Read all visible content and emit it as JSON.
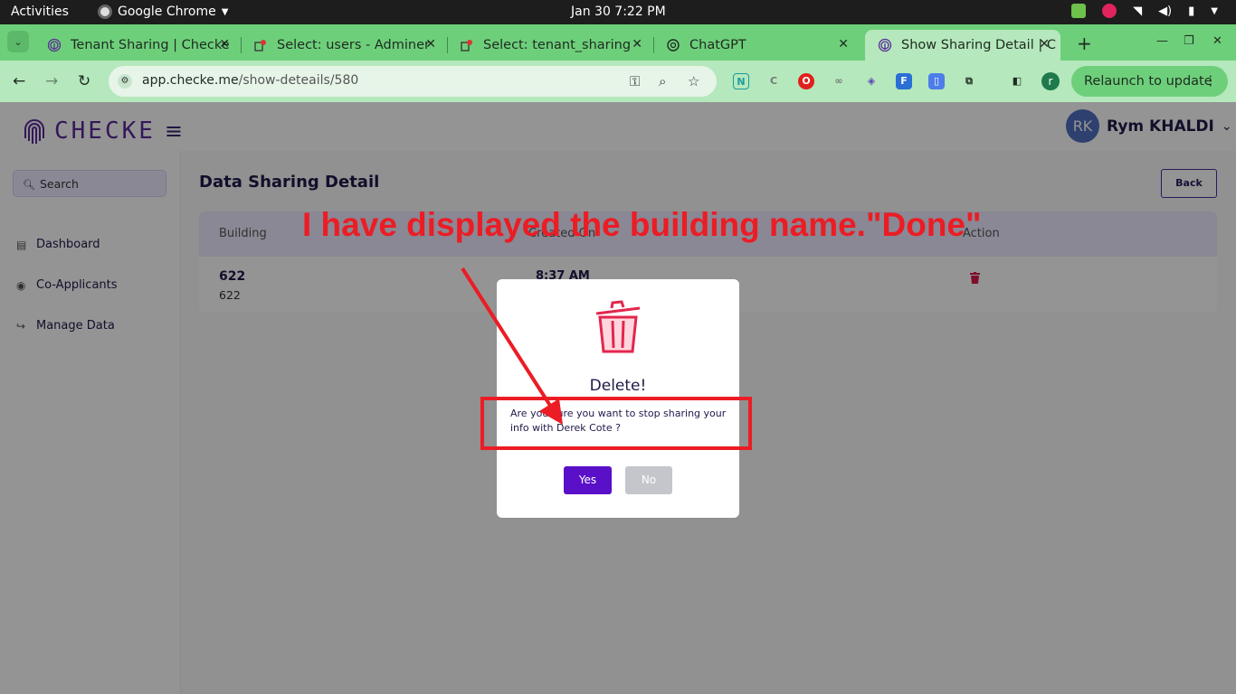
{
  "os_bar": {
    "activities": "Activities",
    "app_name": "Google Chrome",
    "clock": "Jan 30  7:22 PM"
  },
  "tabs": [
    {
      "title": "Tenant Sharing | Checke",
      "icon": "fingerprint-icon"
    },
    {
      "title": "Select: users - Adminer",
      "icon": "adminer-icon"
    },
    {
      "title": "Select: tenant_sharing",
      "icon": "adminer-icon"
    },
    {
      "title": "ChatGPT",
      "icon": "chatgpt-icon"
    },
    {
      "title": "Show Sharing Detail | C",
      "icon": "fingerprint-icon",
      "active": true
    }
  ],
  "toolbar": {
    "url_host": "app.checke.me",
    "url_path": "/show-deteails/580",
    "relaunch_label": "Relaunch to update",
    "profile_initial": "r"
  },
  "app": {
    "brand": "CHECKE",
    "user": {
      "initials": "RK",
      "name": "Rym KHALDI"
    },
    "search_placeholder": "Search",
    "nav": [
      {
        "label": "Dashboard",
        "icon": "document-icon"
      },
      {
        "label": "Co-Applicants",
        "icon": "user-circle-icon"
      },
      {
        "label": "Manage Data",
        "icon": "share-icon"
      }
    ],
    "page_title": "Data Sharing Detail",
    "back_label": "Back",
    "table": {
      "headers": [
        "Building",
        "Created On",
        "Action"
      ],
      "rows": [
        {
          "building_name": "622",
          "building_sub": "622",
          "created_time": "8:37 AM"
        }
      ]
    }
  },
  "modal": {
    "title": "Delete!",
    "message": "Are you sure you want to stop sharing your info with Derek Cote ?",
    "yes_label": "Yes",
    "no_label": "No"
  },
  "annotation": {
    "text": "I have displayed the building name.\"Done\"",
    "color": "#ec1c24"
  },
  "colors": {
    "tab_strip": "#6ecf7b",
    "toolbar": "#b5e8bc",
    "brand_purple": "#5b2a9a",
    "yes_button": "#5a0fc8"
  }
}
